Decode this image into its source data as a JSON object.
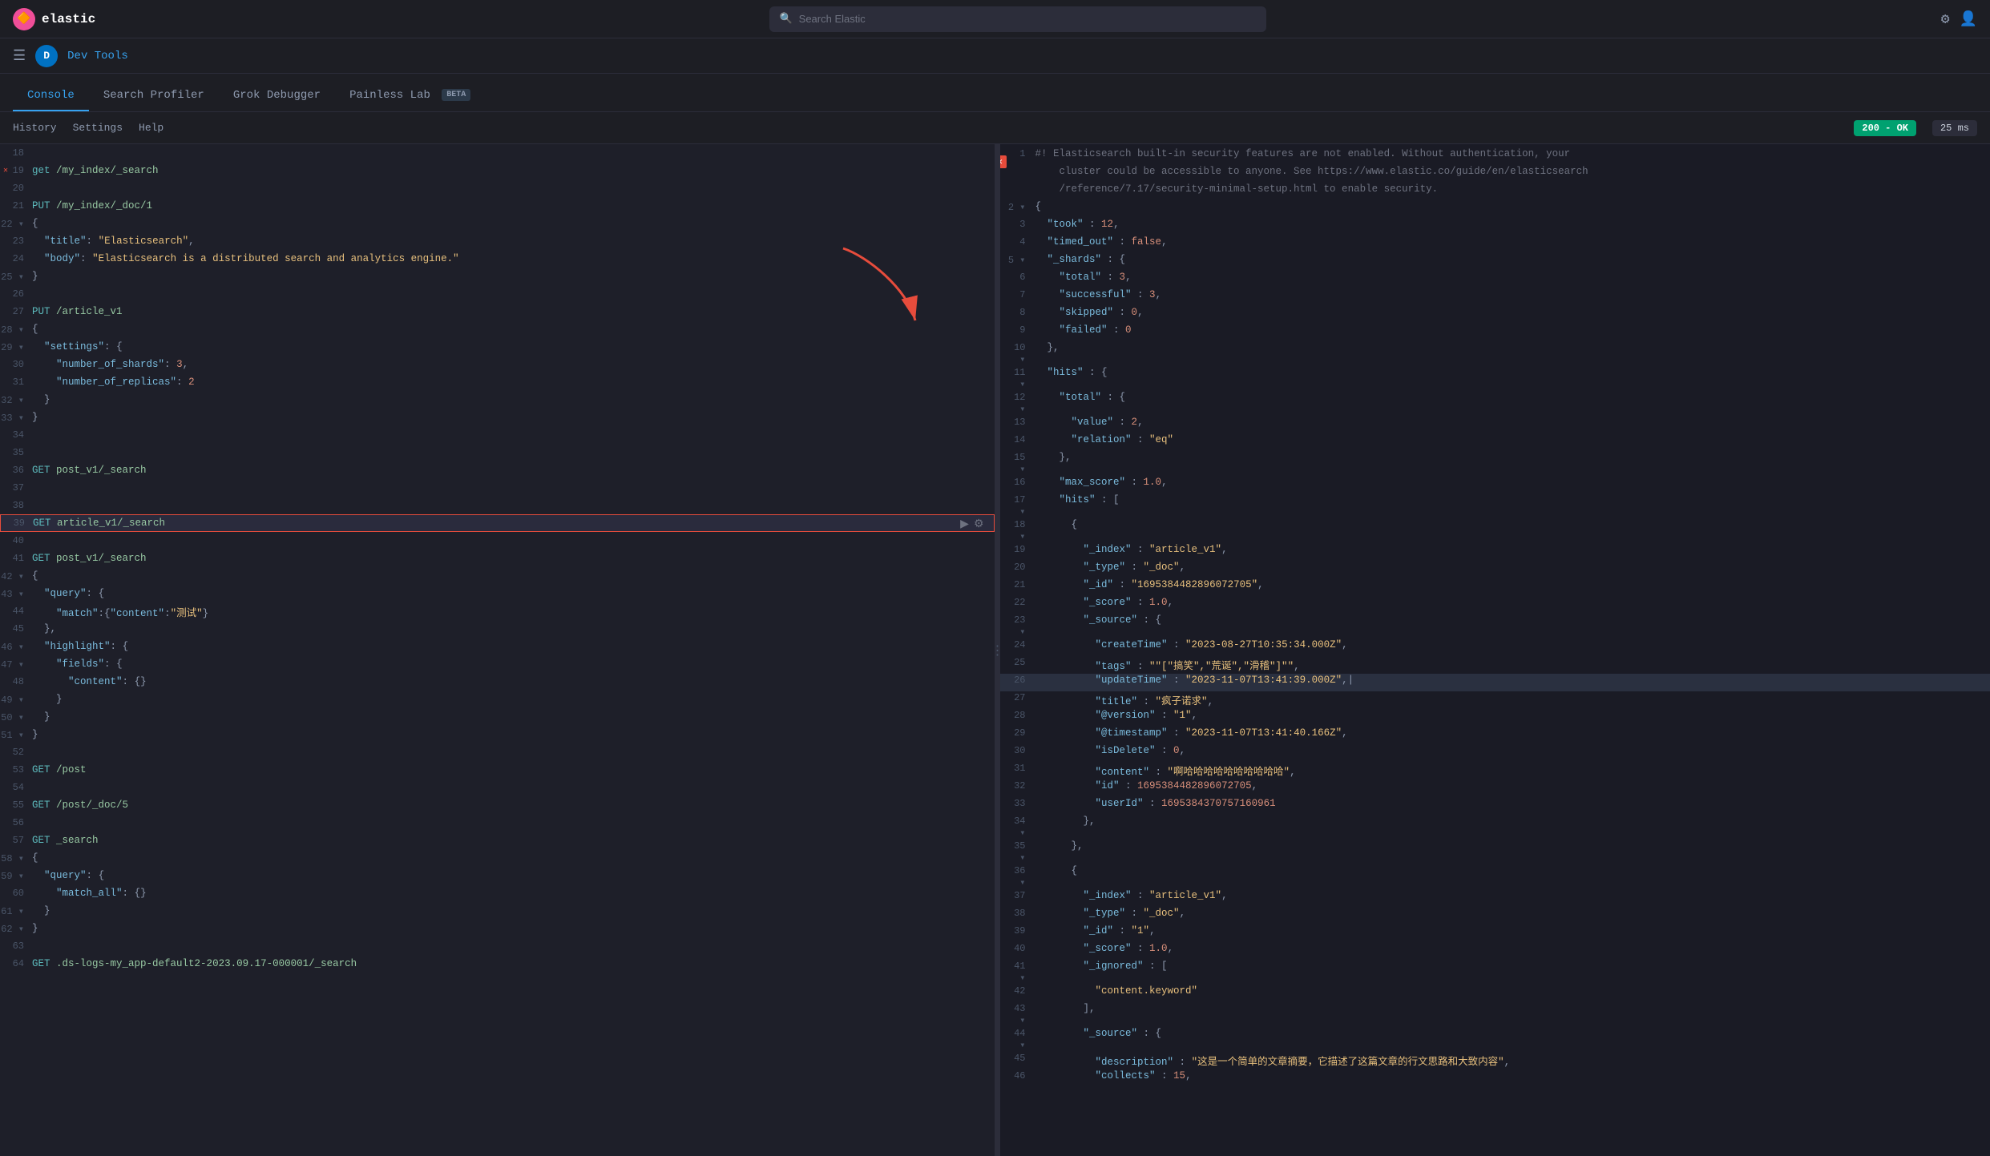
{
  "topBar": {
    "logoText": "elastic",
    "searchPlaceholder": "Search Elastic",
    "iconSettings": "⚙",
    "iconUser": "👤"
  },
  "breadcrumb": {
    "appName": "Dev Tools"
  },
  "tabs": [
    {
      "label": "Console",
      "active": true
    },
    {
      "label": "Search Profiler",
      "active": false
    },
    {
      "label": "Grok Debugger",
      "active": false
    },
    {
      "label": "Painless Lab",
      "active": false,
      "badge": "BETA"
    }
  ],
  "toolbar": {
    "history": "History",
    "settings": "Settings",
    "help": "Help",
    "statusCode": "200 - OK",
    "responseTime": "25 ms"
  },
  "editor": {
    "lines": [
      {
        "num": 18,
        "code": ""
      },
      {
        "num": 19,
        "code": "get /my_index/_search",
        "hasError": true
      },
      {
        "num": 20,
        "code": ""
      },
      {
        "num": 21,
        "code": "PUT /my_index/_doc/1"
      },
      {
        "num": 22,
        "code": "{",
        "folded": true
      },
      {
        "num": 23,
        "code": "  \"title\": \"Elasticsearch\","
      },
      {
        "num": 24,
        "code": "  \"body\": \"Elasticsearch is a distributed search and analytics engine.\""
      },
      {
        "num": 25,
        "code": "}",
        "folded": true
      },
      {
        "num": 26,
        "code": ""
      },
      {
        "num": 27,
        "code": "PUT /article_v1"
      },
      {
        "num": 28,
        "code": "{",
        "folded": true
      },
      {
        "num": 29,
        "code": "  \"settings\": {",
        "folded": true
      },
      {
        "num": 30,
        "code": "    \"number_of_shards\": 3,"
      },
      {
        "num": 31,
        "code": "    \"number_of_replicas\": 2"
      },
      {
        "num": 32,
        "code": "  }",
        "folded": true
      },
      {
        "num": 33,
        "code": "}",
        "folded": true
      },
      {
        "num": 34,
        "code": ""
      },
      {
        "num": 35,
        "code": ""
      },
      {
        "num": 36,
        "code": "GET post_v1/_search"
      },
      {
        "num": 37,
        "code": ""
      },
      {
        "num": 38,
        "code": ""
      },
      {
        "num": 39,
        "code": "GET article_v1/_search",
        "active": true
      },
      {
        "num": 40,
        "code": ""
      },
      {
        "num": 41,
        "code": "GET post_v1/_search"
      },
      {
        "num": 42,
        "code": "{",
        "folded": true
      },
      {
        "num": 43,
        "code": "  \"query\": {",
        "folded": true
      },
      {
        "num": 44,
        "code": "    \"match\":{\"content\":\"测试\"}"
      },
      {
        "num": 45,
        "code": "  },"
      },
      {
        "num": 46,
        "code": "  \"highlight\": {",
        "folded": true
      },
      {
        "num": 47,
        "code": "    \"fields\": {",
        "folded": true
      },
      {
        "num": 48,
        "code": "      \"content\": {}"
      },
      {
        "num": 49,
        "code": "    }",
        "folded": true
      },
      {
        "num": 50,
        "code": "  }",
        "folded": true
      },
      {
        "num": 51,
        "code": "}",
        "folded": true
      },
      {
        "num": 52,
        "code": ""
      },
      {
        "num": 53,
        "code": "GET /post"
      },
      {
        "num": 54,
        "code": ""
      },
      {
        "num": 55,
        "code": "GET /post/_doc/5"
      },
      {
        "num": 56,
        "code": ""
      },
      {
        "num": 57,
        "code": "GET _search"
      },
      {
        "num": 58,
        "code": "{",
        "folded": true
      },
      {
        "num": 59,
        "code": "  \"query\": {",
        "folded": true
      },
      {
        "num": 60,
        "code": "    \"match_all\": {}"
      },
      {
        "num": 61,
        "code": "  }",
        "folded": true
      },
      {
        "num": 62,
        "code": "}",
        "folded": true
      },
      {
        "num": 63,
        "code": ""
      },
      {
        "num": 64,
        "code": "GET .ds-logs-my_app-default2-2023.09.17-000001/_search"
      }
    ]
  },
  "response": {
    "lines": [
      {
        "num": 1,
        "code": "#! Elasticsearch built-in security features are not enabled. Without authentication, your",
        "type": "comment"
      },
      {
        "num": "",
        "code": "    cluster could be accessible to anyone. See https://www.elastic.co/guide/en/elasticsearch",
        "type": "comment"
      },
      {
        "num": "",
        "code": "    /reference/7.17/security-minimal-setup.html to enable security.",
        "type": "comment"
      },
      {
        "num": 2,
        "code": "{",
        "type": "punct",
        "folded": true
      },
      {
        "num": 3,
        "code": "  \"took\" : 12,"
      },
      {
        "num": 4,
        "code": "  \"timed_out\" : false,"
      },
      {
        "num": 5,
        "code": "  \"_shards\" : {",
        "folded": true
      },
      {
        "num": 6,
        "code": "    \"total\" : 3,"
      },
      {
        "num": 7,
        "code": "    \"successful\" : 3,"
      },
      {
        "num": 8,
        "code": "    \"skipped\" : 0,"
      },
      {
        "num": 9,
        "code": "    \"failed\" : 0"
      },
      {
        "num": 10,
        "code": "  },",
        "folded": true
      },
      {
        "num": 11,
        "code": "  \"hits\" : {",
        "folded": true
      },
      {
        "num": 12,
        "code": "    \"total\" : {",
        "folded": true
      },
      {
        "num": 13,
        "code": "      \"value\" : 2,"
      },
      {
        "num": 14,
        "code": "      \"relation\" : \"eq\""
      },
      {
        "num": 15,
        "code": "    },",
        "folded": true
      },
      {
        "num": 16,
        "code": "    \"max_score\" : 1.0,"
      },
      {
        "num": 17,
        "code": "    \"hits\" : [",
        "folded": true
      },
      {
        "num": 18,
        "code": "      {",
        "folded": true
      },
      {
        "num": 19,
        "code": "        \"_index\" : \"article_v1\","
      },
      {
        "num": 20,
        "code": "        \"_type\" : \"_doc\","
      },
      {
        "num": 21,
        "code": "        \"_id\" : \"1695384482896072705\","
      },
      {
        "num": 22,
        "code": "        \"_score\" : 1.0,"
      },
      {
        "num": 23,
        "code": "        \"_source\" : {",
        "folded": true
      },
      {
        "num": 24,
        "code": "          \"createTime\" : \"2023-08-27T10:35:34.000Z\","
      },
      {
        "num": 25,
        "code": "          \"tags\" : \"\"\"[\"搞笑\",\"荒诞\",\"滑稽\"]\"\"\","
      },
      {
        "num": 26,
        "code": "          \"updateTime\" : \"2023-11-07T13:41:39.000Z\",",
        "highlighted": true
      },
      {
        "num": 27,
        "code": "          \"title\" : \"疯子诺求\","
      },
      {
        "num": 28,
        "code": "          \"@version\" : \"1\","
      },
      {
        "num": 29,
        "code": "          \"@timestamp\" : \"2023-11-07T13:41:40.166Z\","
      },
      {
        "num": 30,
        "code": "          \"isDelete\" : 0,"
      },
      {
        "num": 31,
        "code": "          \"content\" : \"啊哈哈哈哈哈哈哈哈哈哈\","
      },
      {
        "num": 32,
        "code": "          \"id\" : 1695384482896072705,"
      },
      {
        "num": 33,
        "code": "          \"userId\" : 1695384370757160961"
      },
      {
        "num": 34,
        "code": "        },",
        "folded": true
      },
      {
        "num": 35,
        "code": "      },",
        "folded": true
      },
      {
        "num": 36,
        "code": "      {",
        "folded": true
      },
      {
        "num": 37,
        "code": "        \"_index\" : \"article_v1\","
      },
      {
        "num": 38,
        "code": "        \"_type\" : \"_doc\","
      },
      {
        "num": 39,
        "code": "        \"_id\" : \"1\","
      },
      {
        "num": 40,
        "code": "        \"_score\" : 1.0,"
      },
      {
        "num": 41,
        "code": "        \"_ignored\" : [",
        "folded": true
      },
      {
        "num": 42,
        "code": "          \"content.keyword\""
      },
      {
        "num": 43,
        "code": "        ],",
        "folded": true
      },
      {
        "num": 44,
        "code": "        \"_source\" : {",
        "folded": true
      },
      {
        "num": 45,
        "code": "          \"description\" : \"这是一个简单的文章摘要，它描述了这篇文章的行文思路和大致内容\","
      },
      {
        "num": 46,
        "code": "          \"collects\" : 15,"
      }
    ]
  }
}
